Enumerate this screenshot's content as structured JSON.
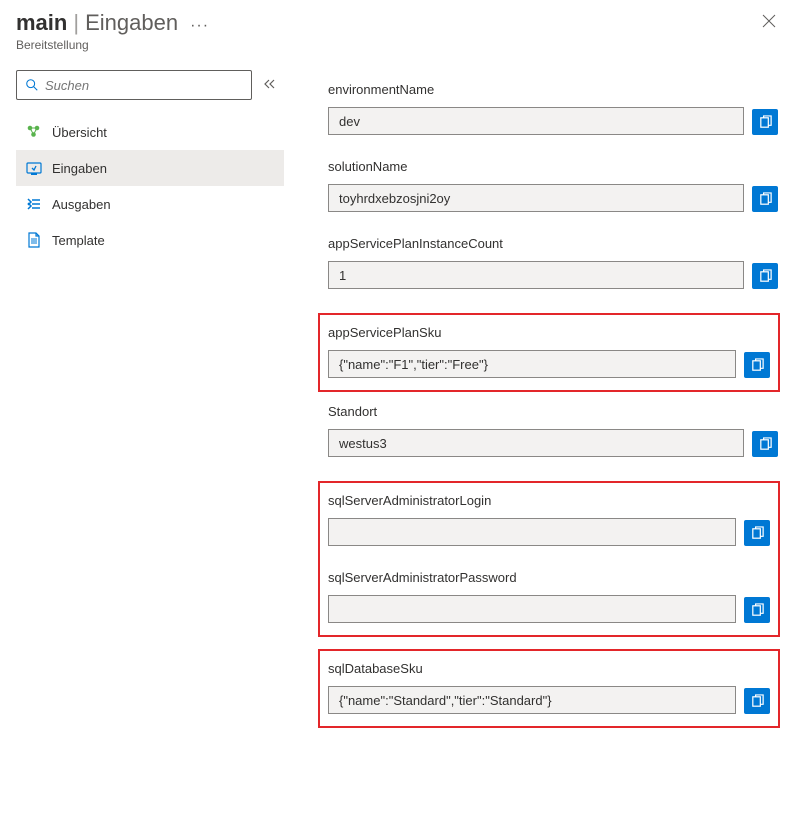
{
  "header": {
    "title_main": "main",
    "title_separator": "|",
    "title_sub": "Eingaben",
    "subtitle": "Bereitstellung"
  },
  "search": {
    "placeholder": "Suchen"
  },
  "sidebar": {
    "items": [
      {
        "label": "Übersicht"
      },
      {
        "label": "Eingaben"
      },
      {
        "label": "Ausgaben"
      },
      {
        "label": "Template"
      }
    ]
  },
  "fields": {
    "environmentName": {
      "label": "environmentName",
      "value": "dev"
    },
    "solutionName": {
      "label": "solutionName",
      "value": "toyhrdxebzosjni2oy"
    },
    "appServicePlanInstanceCount": {
      "label": "appServicePlanInstanceCount",
      "value": "1"
    },
    "appServicePlanSku": {
      "label": "appServicePlanSku",
      "value": "{\"name\":\"F1\",\"tier\":\"Free\"}"
    },
    "standort": {
      "label": "Standort",
      "value": "westus3"
    },
    "sqlServerAdministratorLogin": {
      "label": "sqlServerAdministratorLogin",
      "value": ""
    },
    "sqlServerAdministratorPassword": {
      "label": "sqlServerAdministratorPassword",
      "value": ""
    },
    "sqlDatabaseSku": {
      "label": "sqlDatabaseSku",
      "value": "{\"name\":\"Standard\",\"tier\":\"Standard\"}"
    }
  }
}
